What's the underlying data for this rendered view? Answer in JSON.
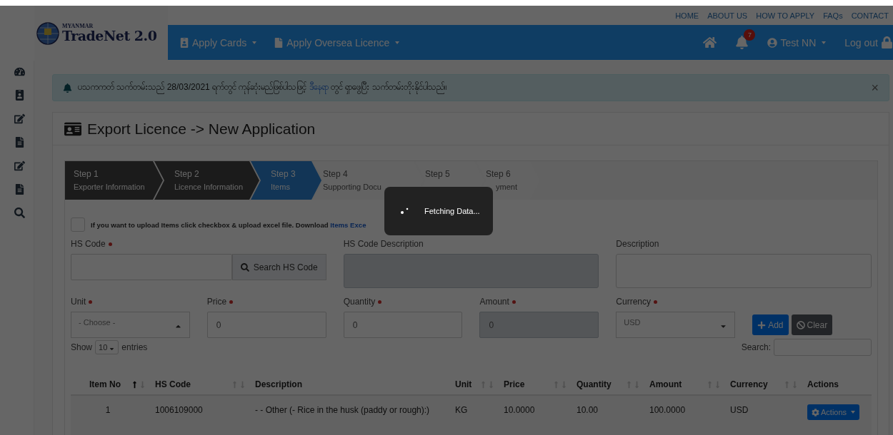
{
  "logo": {
    "small": "MYANMAR",
    "title": "TradeNet 2.0"
  },
  "top_links": [
    "HOME",
    "ABOUT US",
    "HOW TO APPLY",
    "FAQs",
    "CONTACT"
  ],
  "nav": {
    "menus": [
      {
        "label": "Apply Cards",
        "kind": "card"
      },
      {
        "label": "Apply Oversea Licence",
        "kind": "file"
      }
    ],
    "notifications": "7",
    "user": "Test NN",
    "logout": "Log out"
  },
  "sidebar": [
    {
      "kind": "gauge"
    },
    {
      "kind": "card"
    },
    {
      "kind": "edit"
    },
    {
      "kind": "doc"
    },
    {
      "kind": "edit"
    },
    {
      "kind": "doc"
    },
    {
      "kind": "search"
    }
  ],
  "alert": {
    "text": "ပသကကတ် သက်တမ်းသည် 28/03/2021 ရက်တွင် ကုန်ဆုံးမည်ဖြစ်ပါသဖြင့်",
    "link": "ဒီနေရာ",
    "text_after": "တွင် ရှာဖွေပြီး သက်တမ်းတိုးနိုင်ပါသည်။",
    "close": "×"
  },
  "page_title": "Export Licence -> New Application",
  "steps": [
    {
      "step": "Step 1",
      "label": "Exporter Information",
      "done": true,
      "selected": false
    },
    {
      "step": "Step 2",
      "label": "Licence Information",
      "done": true,
      "selected": false
    },
    {
      "step": "Step 3",
      "label": "Items",
      "done": false,
      "selected": true
    },
    {
      "step": "Step 4",
      "label": "Supporting Docu",
      "done": false,
      "selected": false
    },
    {
      "step": "Step 5",
      "done": false,
      "selected": false
    },
    {
      "step": "Step 6",
      "label": "yment",
      "done": false,
      "selected": false
    }
  ],
  "upload": {
    "checked": false,
    "text": "If you want to upload Items click checkbox & upload excel file. Download",
    "link": "Items Exce"
  },
  "fields": [
    {
      "label": "HS Code",
      "required": true,
      "kind": "search",
      "button": "Search HS Code"
    },
    {
      "label": "HS Code Description",
      "required": false,
      "kind": "textarea",
      "disabled": true
    },
    {
      "label": "Description",
      "required": false,
      "kind": "textarea",
      "disabled": false
    },
    {
      "label": "Unit",
      "required": true,
      "kind": "select",
      "value": "- Choose -",
      "expanded": true
    },
    {
      "label": "Price",
      "required": true,
      "kind": "input",
      "value": "0",
      "disabled": false
    },
    {
      "label": "Quantity",
      "required": true,
      "kind": "input",
      "value": "0",
      "disabled": false
    },
    {
      "label": "Amount",
      "required": true,
      "kind": "input",
      "value": "0",
      "disabled": true
    },
    {
      "label": "Currency",
      "required": true,
      "kind": "select",
      "value": "USD",
      "expanded": false
    }
  ],
  "buttons": [
    {
      "label": "Add",
      "kind": "primary"
    },
    {
      "label": "Clear",
      "kind": "secondary"
    }
  ],
  "table_controls": {
    "show": "Show",
    "page_size": "10",
    "entries": "entries",
    "search": "Search:"
  },
  "table": {
    "columns": [
      {
        "label": "Item No",
        "sortable": true,
        "sorted": true
      },
      {
        "label": "HS Code",
        "sortable": true,
        "sorted": false
      },
      {
        "label": "Description",
        "sortable": false,
        "sorted": false
      },
      {
        "label": "Unit",
        "sortable": true,
        "sorted": false
      },
      {
        "label": "Price",
        "sortable": true,
        "sorted": false
      },
      {
        "label": "Quantity",
        "sortable": true,
        "sorted": false
      },
      {
        "label": "Amount",
        "sortable": true,
        "sorted": false
      },
      {
        "label": "Currency",
        "sortable": true,
        "sorted": false
      },
      {
        "label": "Actions",
        "sortable": false,
        "sorted": false
      }
    ],
    "rows": [
      {
        "cells": [
          "1",
          "1006109000",
          "- - Other (- Rice in the husk (paddy or rough):)",
          "KG",
          "10.0000",
          "10.00",
          "100.0000",
          "USD"
        ],
        "action": "Actions"
      }
    ]
  },
  "loading": {
    "text": "Fetching Data..."
  }
}
